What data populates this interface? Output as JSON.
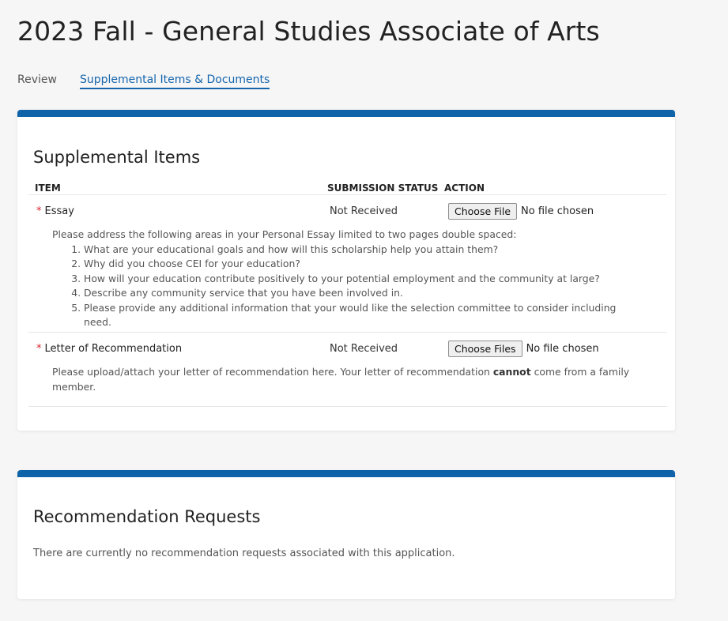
{
  "page_title": "2023 Fall - General Studies Associate of Arts",
  "tabs": [
    {
      "label": "Review",
      "active": false
    },
    {
      "label": "Supplemental Items & Documents",
      "active": true
    }
  ],
  "supplemental": {
    "title": "Supplemental Items",
    "columns": {
      "item": "ITEM",
      "status": "SUBMISSION STATUS",
      "action": "ACTION"
    },
    "required_marker": "*",
    "items": [
      {
        "name": "Essay",
        "status": "Not Received",
        "button_label": "Choose File",
        "file_text": "No file chosen",
        "description_intro": "Please address the following areas in your Personal Essay limited to two pages double spaced:",
        "description_list": [
          "What are your educational goals and how will this scholarship help you attain them?",
          "Why did you choose CEI for your education?",
          "How will your education contribute positively to your potential employment and the community at large?",
          "Describe any community service that you have been involved in.",
          "Please provide any additional information that your would like the selection committee to consider including need."
        ]
      },
      {
        "name": "Letter of Recommendation",
        "status": "Not Received",
        "button_label": "Choose Files",
        "file_text": "No file chosen",
        "description_pre": "Please upload/attach your letter of recommendation here. Your letter of recommendation ",
        "description_bold": "cannot",
        "description_post": " come from a family member."
      }
    ]
  },
  "recommendations": {
    "title": "Recommendation Requests",
    "empty_text": "There are currently no recommendation requests associated with this application."
  },
  "colors": {
    "accent": "#0f63a8",
    "link": "#1565ad",
    "required": "#d9242b"
  }
}
